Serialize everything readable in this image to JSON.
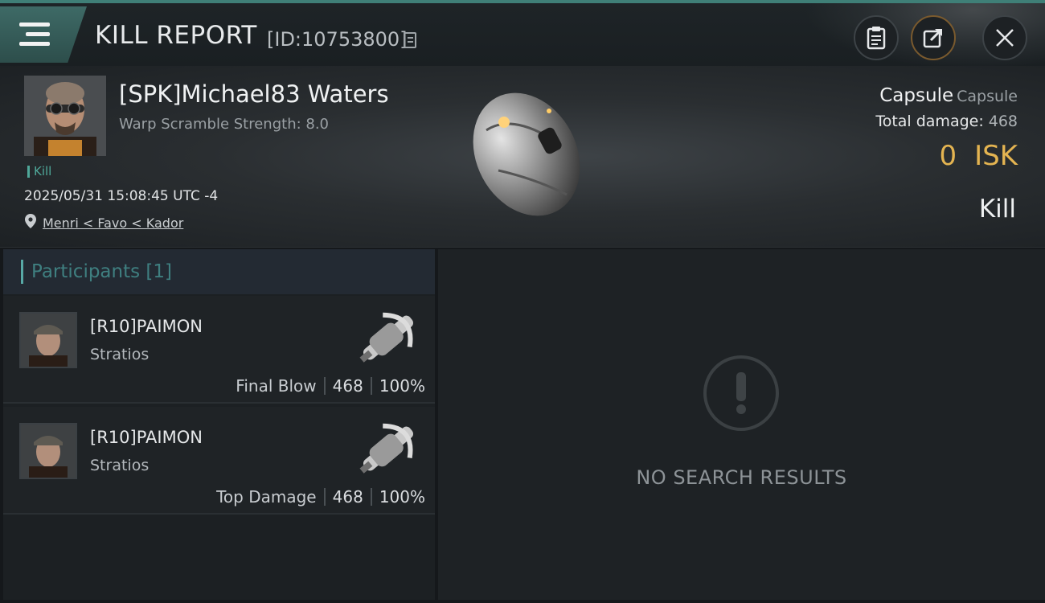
{
  "header": {
    "title": "KILL REPORT",
    "report_id": "[ID:10753800]",
    "icons": {
      "menu": "menu-icon",
      "copy": "copy-icon",
      "clipboard": "clipboard-icon",
      "share": "share-icon",
      "close": "close-icon"
    }
  },
  "victim": {
    "name": "[SPK]Michael83 Waters",
    "subtitle": "Warp Scramble Strength: 8.0",
    "tag": "Kill",
    "datetime": "2025/05/31 15:08:45 UTC -4",
    "location": "Menri < Favo < Kador",
    "ship_name": "Capsule",
    "ship_class": "Capsule",
    "damage_label": "Total damage:",
    "damage_value": "468",
    "isk_value": "0",
    "isk_unit": "ISK",
    "result": "Kill"
  },
  "participants": {
    "header": "Participants [1]",
    "items": [
      {
        "name": "[R10]PAIMON",
        "ship": "Stratios",
        "label": "Final Blow",
        "damage": "468",
        "percent": "100%"
      },
      {
        "name": "[R10]PAIMON",
        "ship": "Stratios",
        "label": "Top Damage",
        "damage": "468",
        "percent": "100%"
      }
    ]
  },
  "results": {
    "empty_text": "NO SEARCH RESULTS"
  },
  "colors": {
    "accent_teal": "#4fa89a",
    "isk_gold": "#e4b451",
    "background": "#15181b"
  }
}
